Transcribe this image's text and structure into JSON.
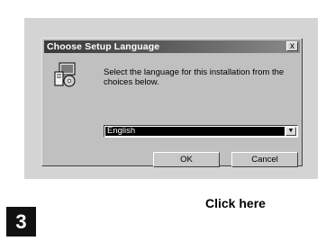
{
  "dialog": {
    "title": "Choose Setup Language",
    "close_glyph": "x",
    "icon": "setup-computer-icon",
    "message": "Select the language for this installation from the choices below.",
    "language_select": {
      "value": "English"
    },
    "ok_label": "OK",
    "cancel_label": "Cancel"
  },
  "step_number": "3",
  "callout": "Click here"
}
